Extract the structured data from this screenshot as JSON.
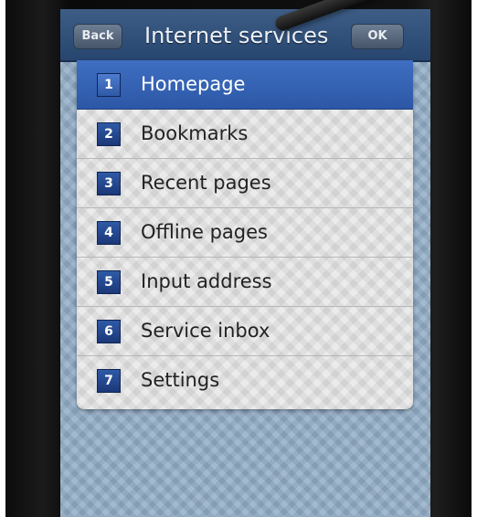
{
  "titlebar": {
    "back_label": "Back",
    "title": "Internet services",
    "ok_label": "OK"
  },
  "menu": {
    "items": [
      {
        "number": "1",
        "label": "Homepage",
        "selected": true
      },
      {
        "number": "2",
        "label": "Bookmarks",
        "selected": false
      },
      {
        "number": "3",
        "label": "Recent pages",
        "selected": false
      },
      {
        "number": "4",
        "label": "Offline pages",
        "selected": false
      },
      {
        "number": "5",
        "label": "Input address",
        "selected": false
      },
      {
        "number": "6",
        "label": "Service inbox",
        "selected": false
      },
      {
        "number": "7",
        "label": "Settings",
        "selected": false
      }
    ]
  },
  "colors": {
    "titlebar": "#2f4e78",
    "selection": "#3462b4",
    "menu_background": "#e9e9e9",
    "screen_background": "#8faac4"
  }
}
